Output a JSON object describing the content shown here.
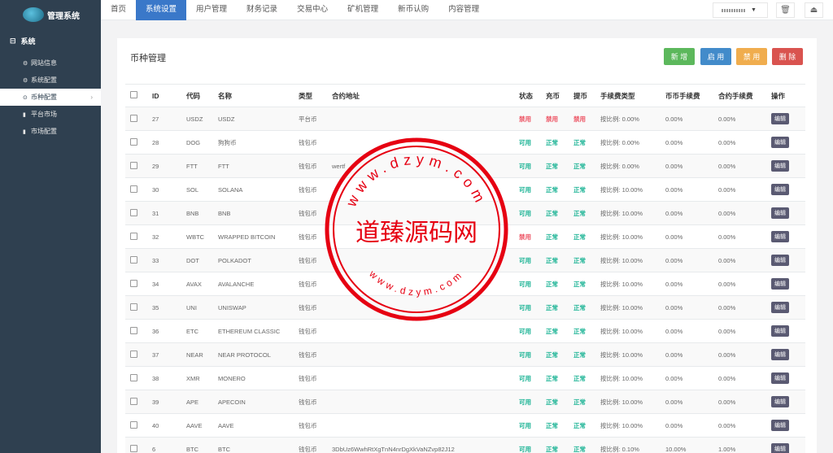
{
  "brand": {
    "title": "管理系统"
  },
  "sidebar": {
    "group_label": "系统",
    "items": [
      {
        "label": "网站信息",
        "icon": "gear-icon"
      },
      {
        "label": "系统配置",
        "icon": "gear-icon"
      },
      {
        "label": "币种配置",
        "icon": "circle-icon",
        "active": true
      },
      {
        "label": "平台市场",
        "icon": "bar-chart-icon"
      },
      {
        "label": "市场配置",
        "icon": "bar-chart-icon"
      }
    ]
  },
  "topnav": {
    "tabs": [
      "首页",
      "系统设置",
      "用户管理",
      "财务记录",
      "交易中心",
      "矿机管理",
      "新币认购",
      "内容管理"
    ],
    "active": "系统设置"
  },
  "panel": {
    "title": "币种管理",
    "buttons": {
      "add": "新 增",
      "enable": "启 用",
      "disable": "禁 用",
      "delete": "删 除"
    }
  },
  "table": {
    "headers": [
      "",
      "ID",
      "代码",
      "名称",
      "类型",
      "合约地址",
      "状态",
      "充币",
      "提币",
      "手续费类型",
      "币币手续费",
      "合约手续费",
      "操作"
    ],
    "edit_label": "编辑",
    "rows": [
      [
        "27",
        "USDZ",
        "USDZ",
        "平台币",
        "",
        "禁用",
        "禁用",
        "禁用",
        "按比例: 0.00%",
        "0.00%",
        "0.00%"
      ],
      [
        "28",
        "DOG",
        "狗狗币",
        "钱包币",
        "",
        "可用",
        "正常",
        "正常",
        "按比例: 0.00%",
        "0.00%",
        "0.00%"
      ],
      [
        "29",
        "FTT",
        "FTT",
        "钱包币",
        "wertf",
        "可用",
        "正常",
        "正常",
        "按比例: 0.00%",
        "0.00%",
        "0.00%"
      ],
      [
        "30",
        "SOL",
        "SOLANA",
        "钱包币",
        "",
        "可用",
        "正常",
        "正常",
        "按比例: 10.00%",
        "0.00%",
        "0.00%"
      ],
      [
        "31",
        "BNB",
        "BNB",
        "钱包币",
        "",
        "可用",
        "正常",
        "正常",
        "按比例: 10.00%",
        "0.00%",
        "0.00%"
      ],
      [
        "32",
        "WBTC",
        "WRAPPED BITCOIN",
        "钱包币",
        "",
        "禁用",
        "正常",
        "正常",
        "按比例: 10.00%",
        "0.00%",
        "0.00%"
      ],
      [
        "33",
        "DOT",
        "POLKADOT",
        "钱包币",
        "",
        "可用",
        "正常",
        "正常",
        "按比例: 10.00%",
        "0.00%",
        "0.00%"
      ],
      [
        "34",
        "AVAX",
        "AVALANCHE",
        "钱包币",
        "",
        "可用",
        "正常",
        "正常",
        "按比例: 10.00%",
        "0.00%",
        "0.00%"
      ],
      [
        "35",
        "UNI",
        "UNISWAP",
        "钱包币",
        "",
        "可用",
        "正常",
        "正常",
        "按比例: 10.00%",
        "0.00%",
        "0.00%"
      ],
      [
        "36",
        "ETC",
        "ETHEREUM CLASSIC",
        "钱包币",
        "",
        "可用",
        "正常",
        "正常",
        "按比例: 10.00%",
        "0.00%",
        "0.00%"
      ],
      [
        "37",
        "NEAR",
        "NEAR PROTOCOL",
        "钱包币",
        "",
        "可用",
        "正常",
        "正常",
        "按比例: 10.00%",
        "0.00%",
        "0.00%"
      ],
      [
        "38",
        "XMR",
        "MONERO",
        "钱包币",
        "",
        "可用",
        "正常",
        "正常",
        "按比例: 10.00%",
        "0.00%",
        "0.00%"
      ],
      [
        "39",
        "APE",
        "APECOIN",
        "钱包币",
        "",
        "可用",
        "正常",
        "正常",
        "按比例: 10.00%",
        "0.00%",
        "0.00%"
      ],
      [
        "40",
        "AAVE",
        "AAVE",
        "钱包币",
        "",
        "可用",
        "正常",
        "正常",
        "按比例: 10.00%",
        "0.00%",
        "0.00%"
      ],
      [
        "6",
        "BTC",
        "BTC",
        "钱包币",
        "3DbUz6WwhRtXgTnN4nrDgXkVaNZvp82J12",
        "可用",
        "正常",
        "正常",
        "按比例: 0.10%",
        "10.00%",
        "1.00%"
      ]
    ]
  },
  "watermark": {
    "text": "道臻源码网",
    "ring": "www.dzym.com"
  },
  "colors": {
    "sidebar": "#2f4050",
    "active_tab": "#3a78c9",
    "on": "#1ab394",
    "off": "#ed5565",
    "stamp": "#e60012"
  }
}
